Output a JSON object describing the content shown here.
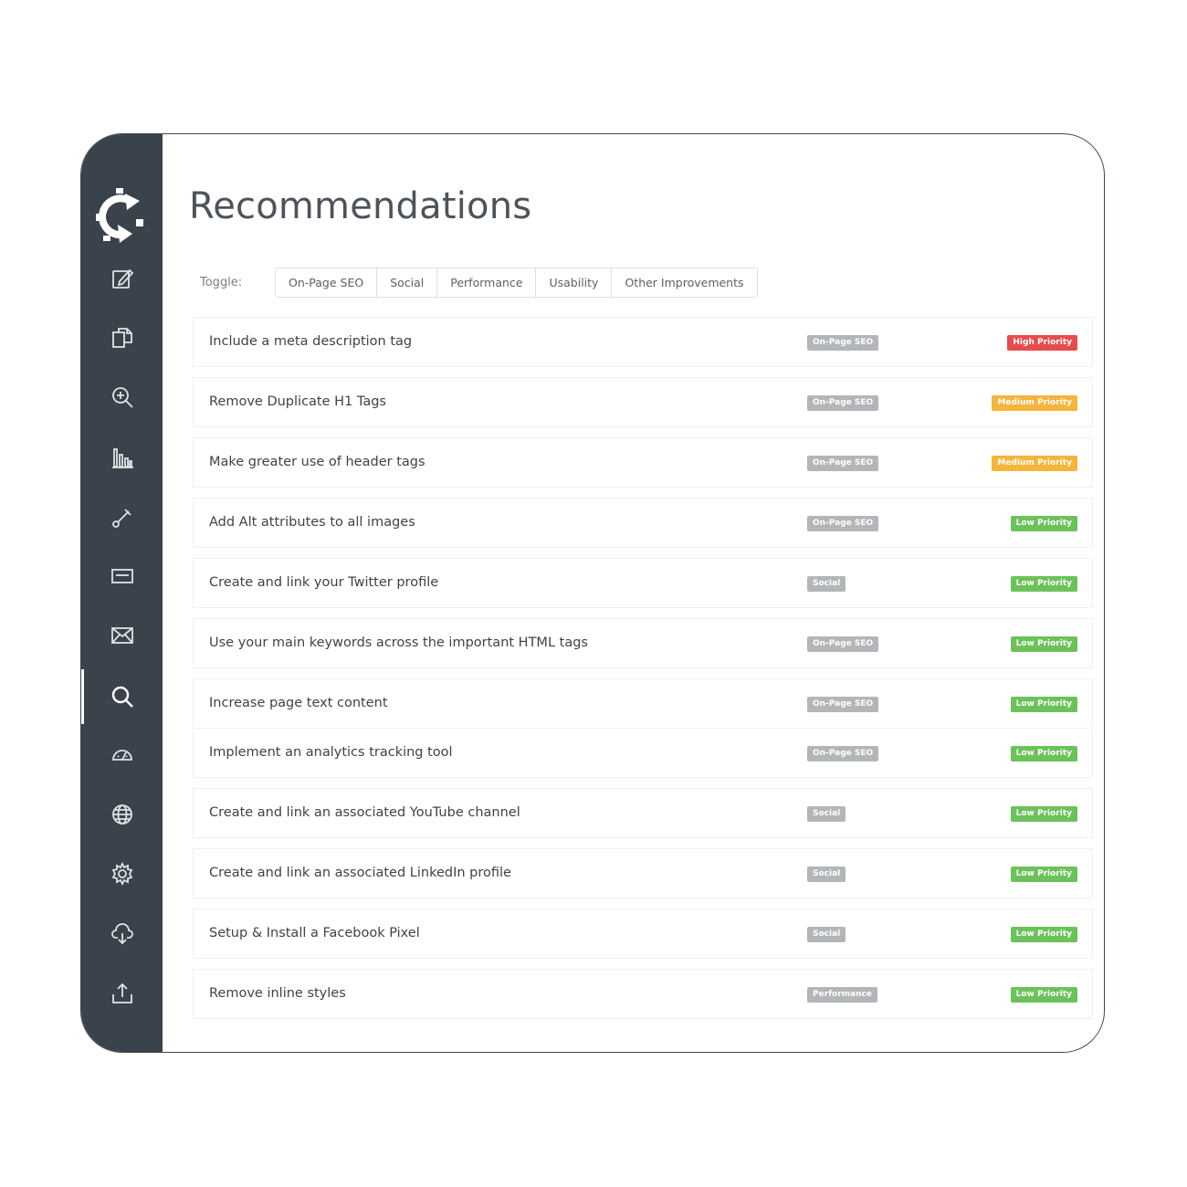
{
  "page": {
    "title": "Recommendations"
  },
  "toggle": {
    "label": "Toggle:",
    "options": [
      "On-Page SEO",
      "Social",
      "Performance",
      "Usability",
      "Other Improvements"
    ]
  },
  "colors": {
    "sidebar_bg": "#3a434c",
    "high_priority": "#e94b4b",
    "medium_priority": "#f5b43a",
    "low_priority": "#6cc25a",
    "category_badge": "#b3b6b9"
  },
  "sidebar": {
    "logo": "gear-sync-logo-icon",
    "items": [
      {
        "icon": "edit-icon"
      },
      {
        "icon": "documents-icon"
      },
      {
        "icon": "zoom-in-icon"
      },
      {
        "icon": "bar-chart-icon"
      },
      {
        "icon": "link-icon"
      },
      {
        "icon": "card-icon"
      },
      {
        "icon": "mail-icon"
      },
      {
        "icon": "search-icon",
        "active": true
      },
      {
        "icon": "gauge-icon"
      },
      {
        "icon": "globe-icon"
      },
      {
        "icon": "gear-icon"
      },
      {
        "icon": "cloud-download-icon"
      },
      {
        "icon": "upload-icon"
      }
    ]
  },
  "recommendations": [
    {
      "title": "Include a meta description tag",
      "category": "On-Page SEO",
      "priority": "High Priority",
      "level": "high"
    },
    {
      "title": "Remove Duplicate H1 Tags",
      "category": "On-Page SEO",
      "priority": "Medium Priority",
      "level": "medium"
    },
    {
      "title": "Make greater use of header tags",
      "category": "On-Page SEO",
      "priority": "Medium Priority",
      "level": "medium"
    },
    {
      "title": "Add Alt attributes to all images",
      "category": "On-Page SEO",
      "priority": "Low Priority",
      "level": "low"
    },
    {
      "title": "Create and link your Twitter profile",
      "category": "Social",
      "priority": "Low Priority",
      "level": "low"
    },
    {
      "title": "Use your main keywords across the important HTML tags",
      "category": "On-Page SEO",
      "priority": "Low Priority",
      "level": "low"
    },
    {
      "title": "Increase page text content",
      "category": "On-Page SEO",
      "priority": "Low Priority",
      "level": "low"
    },
    {
      "title": "Implement an analytics tracking tool",
      "category": "On-Page SEO",
      "priority": "Low Priority",
      "level": "low"
    },
    {
      "title": "Create and link an associated YouTube channel",
      "category": "Social",
      "priority": "Low Priority",
      "level": "low"
    },
    {
      "title": "Create and link an associated LinkedIn profile",
      "category": "Social",
      "priority": "Low Priority",
      "level": "low"
    },
    {
      "title": "Setup & Install a Facebook Pixel",
      "category": "Social",
      "priority": "Low Priority",
      "level": "low"
    },
    {
      "title": "Remove inline styles",
      "category": "Performance",
      "priority": "Low Priority",
      "level": "low"
    }
  ]
}
